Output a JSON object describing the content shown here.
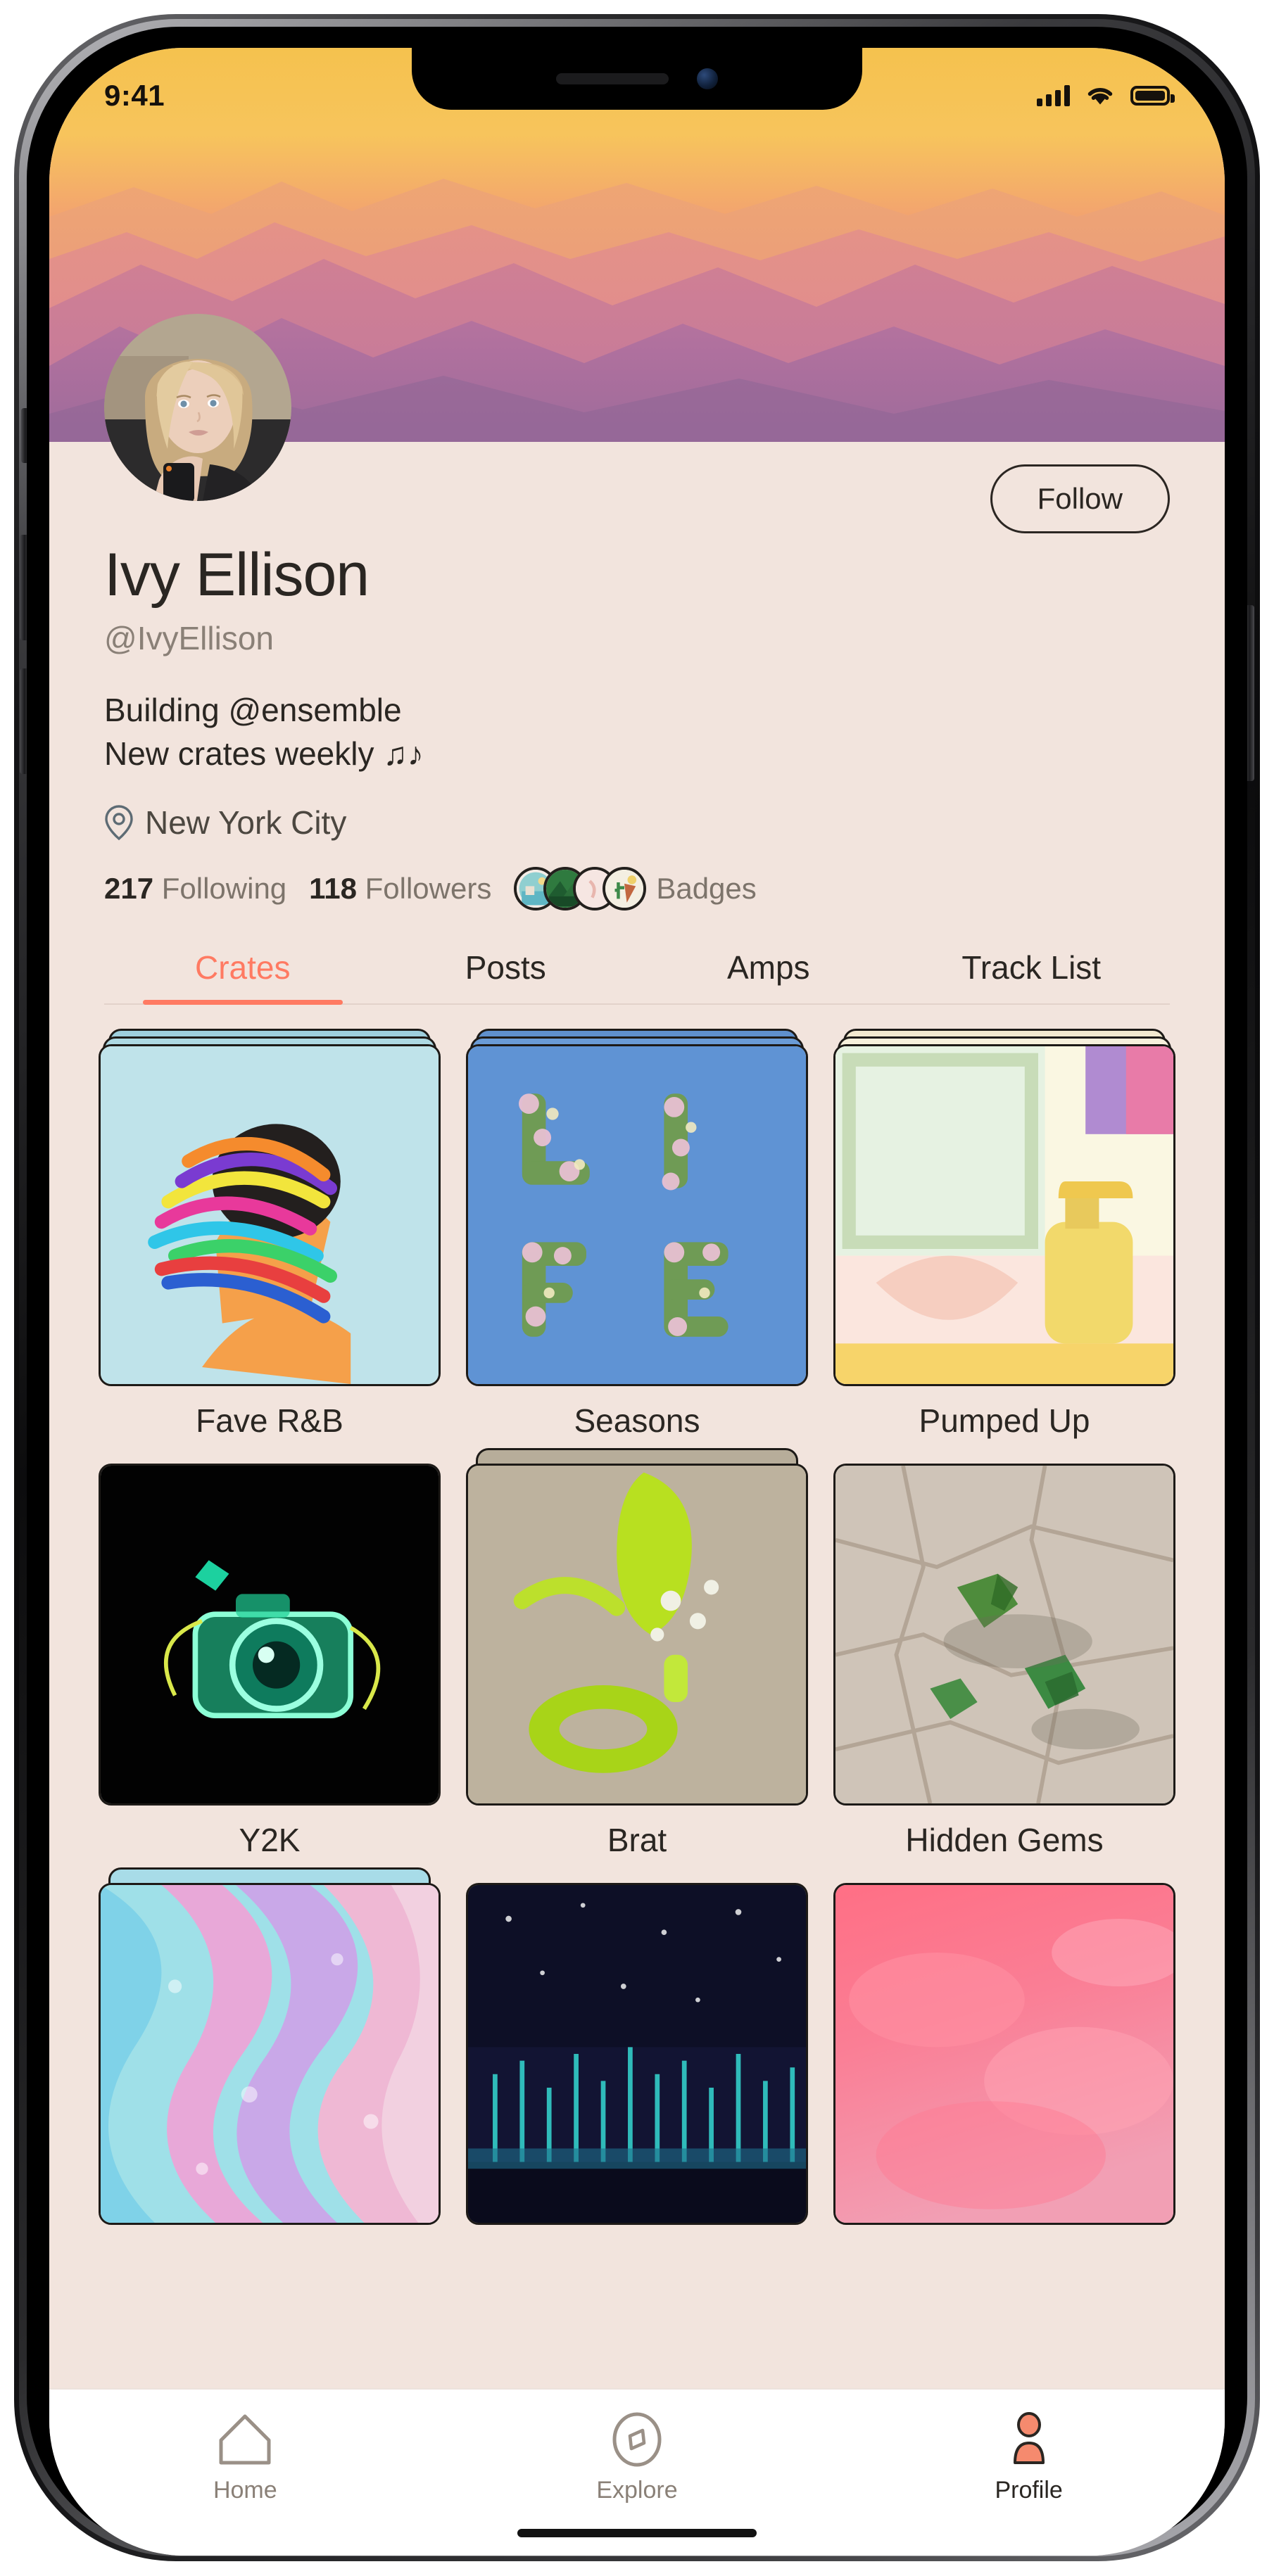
{
  "status_bar": {
    "time": "9:41",
    "signal_icon": "cellular-bars-icon",
    "wifi_icon": "wifi-icon",
    "battery_icon": "battery-icon"
  },
  "profile": {
    "avatar_icon": "user-avatar",
    "follow_label": "Follow",
    "display_name": "Ivy Ellison",
    "handle": "@IvyEllison",
    "bio_line1": "Building @ensemble",
    "bio_line2": "New crates weekly ♫♪",
    "location_icon": "location-pin-icon",
    "location": "New York City",
    "following_count": "217",
    "following_label": "Following",
    "followers_count": "118",
    "followers_label": "Followers",
    "badges_label": "Badges",
    "badges": [
      {
        "name": "badge-coastal"
      },
      {
        "name": "badge-forest"
      },
      {
        "name": "badge-blush"
      },
      {
        "name": "badge-desert"
      }
    ]
  },
  "tabs": [
    {
      "label": "Crates",
      "active": true
    },
    {
      "label": "Posts",
      "active": false
    },
    {
      "label": "Amps",
      "active": false
    },
    {
      "label": "Track List",
      "active": false
    }
  ],
  "crates": [
    {
      "name": "Fave R&B",
      "art": "paint-streak-portrait"
    },
    {
      "name": "Seasons",
      "art": "floral-life-letters"
    },
    {
      "name": "Pumped Up",
      "art": "soap-dispenser-hands"
    },
    {
      "name": "Y2K",
      "art": "neon-green-camera"
    },
    {
      "name": "Brat",
      "art": "lime-green-objects"
    },
    {
      "name": "Hidden Gems",
      "art": "green-gems-cracked-earth"
    },
    {
      "name": "",
      "art": "pastel-marble-swirl"
    },
    {
      "name": "",
      "art": "night-city-lights"
    },
    {
      "name": "",
      "art": "pink-cloud-gradient"
    }
  ],
  "bottom_nav": [
    {
      "label": "Home",
      "icon": "home-icon",
      "active": false
    },
    {
      "label": "Explore",
      "icon": "compass-icon",
      "active": false
    },
    {
      "label": "Profile",
      "icon": "person-icon",
      "active": true
    }
  ],
  "colors": {
    "accent": "#FF7A62",
    "page_bg": "#F2E4DD",
    "text_primary": "#2A2622",
    "text_muted": "#8A8077",
    "nav_bg": "#FFFFFF"
  }
}
